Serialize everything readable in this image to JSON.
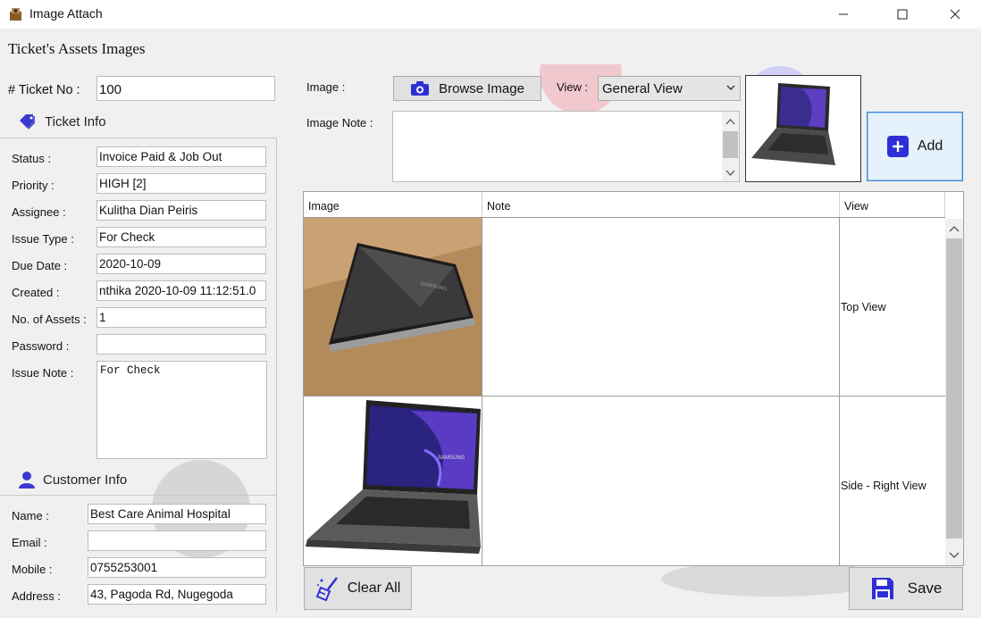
{
  "window": {
    "title": "Image Attach"
  },
  "header": {
    "title": "Ticket's Assets Images"
  },
  "ticket": {
    "label": "# Ticket No :",
    "value": "100"
  },
  "ticket_info": {
    "heading": "Ticket Info",
    "fields": [
      {
        "label": "Status :",
        "value": "Invoice Paid & Job Out"
      },
      {
        "label": "Priority :",
        "value": "HIGH [2]"
      },
      {
        "label": "Assignee :",
        "value": "Kulitha Dian Peiris"
      },
      {
        "label": "Issue Type :",
        "value": "For Check"
      },
      {
        "label": "Due Date :",
        "value": "2020-10-09"
      },
      {
        "label": "Created :",
        "value": "nthika 2020-10-09 11:12:51.0"
      },
      {
        "label": "No. of Assets :",
        "value": "1"
      },
      {
        "label": "Password :",
        "value": ""
      }
    ],
    "issue_note": {
      "label": "Issue Note :",
      "value": "For Check"
    }
  },
  "customer_info": {
    "heading": "Customer Info",
    "fields": [
      {
        "label": "Name :",
        "value": "Best Care Animal Hospital"
      },
      {
        "label": "Email :",
        "value": ""
      },
      {
        "label": "Mobile :",
        "value": "0755253001"
      },
      {
        "label": "Address :",
        "value": "43, Pagoda Rd, Nugegoda"
      }
    ]
  },
  "image_form": {
    "image_label": "Image :",
    "browse_label": "Browse Image",
    "view_label": "View :",
    "view_selected": "General View",
    "note_label": "Image Note :",
    "note_value": "",
    "add_label": "Add"
  },
  "table": {
    "headers": [
      "Image",
      "Note",
      "View"
    ],
    "rows": [
      {
        "note": "",
        "view": "Top View"
      },
      {
        "note": "",
        "view": "Side - Right View"
      }
    ]
  },
  "actions": {
    "clear_label": "Clear All",
    "save_label": "Save"
  },
  "colors": {
    "accent_blue": "#2f2fd8",
    "icon_purple": "#3a3ad0"
  }
}
